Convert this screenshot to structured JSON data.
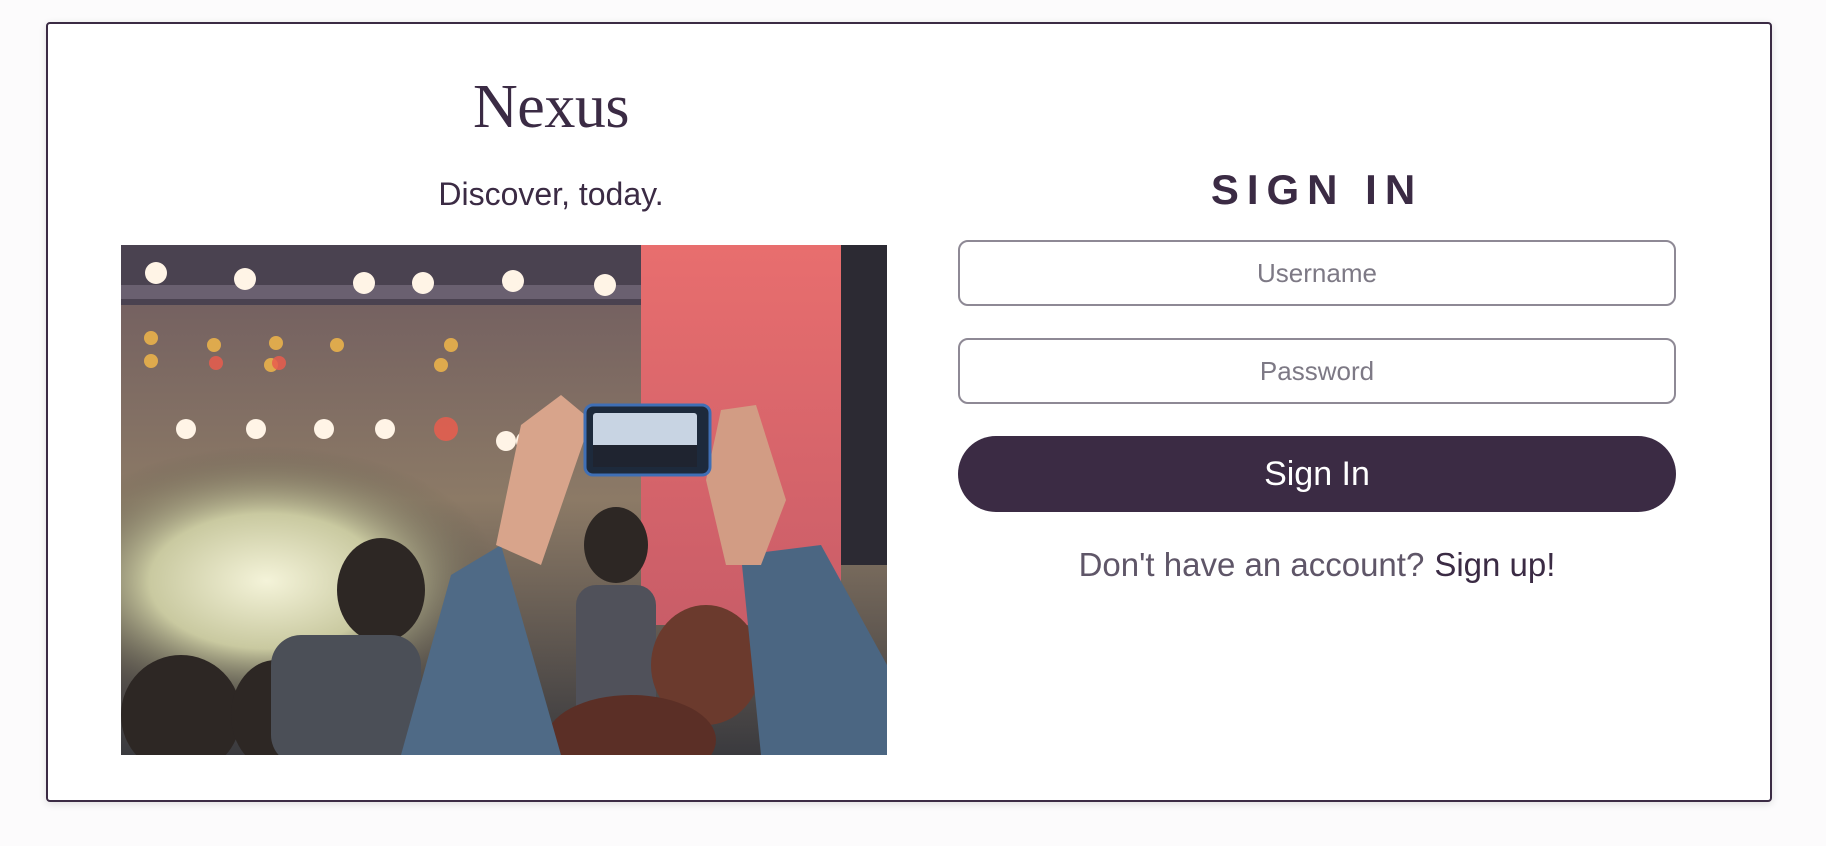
{
  "brand": {
    "name": "Nexus",
    "tagline": "Discover, today."
  },
  "hero_image": {
    "alt": "Concert crowd with a person filming the stage on a phone"
  },
  "signin": {
    "title": "SIGN IN",
    "username_placeholder": "Username",
    "password_placeholder": "Password",
    "submit_label": "Sign In",
    "no_account_text": "Don't have an account?",
    "signup_link": "Sign up!"
  },
  "colors": {
    "primary": "#3b2b44",
    "field_border": "#8e8995",
    "page_background": "#fcfbfc"
  }
}
